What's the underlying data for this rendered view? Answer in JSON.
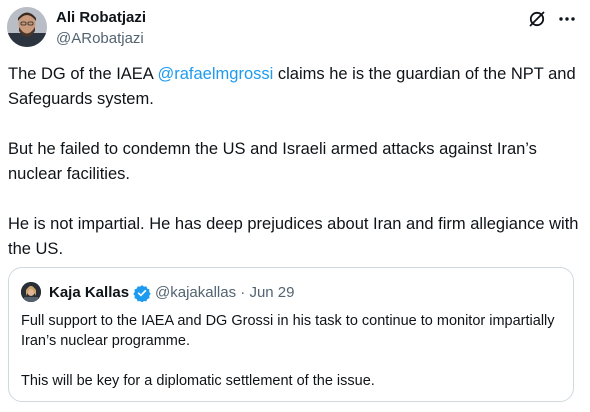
{
  "author": {
    "name": "Ali Robatjazi",
    "handle": "@ARobatjazi",
    "avatar_icon": "profile-photo"
  },
  "actions": {
    "grok_icon": "slashed-circle-icon",
    "more_icon": "three-dots-icon"
  },
  "tweet": {
    "p1_prefix": "The DG of the IAEA ",
    "p1_mention": "@rafaelmgrossi",
    "p1_suffix": " claims he is the guardian of the NPT and Safeguards system.",
    "p2": "But he failed to condemn the US and Israeli armed attacks against Iran’s nuclear facilities.",
    "p3": "He is not impartial. He has deep prejudices about Iran and firm allegiance with the US."
  },
  "quote": {
    "name": "Kaja Kallas",
    "handle": "@kajakallas",
    "separator": "·",
    "date": "Jun 29",
    "p1": "Full support to the IAEA and DG Grossi in his task to continue to monitor impartially Iran’s nuclear programme.",
    "p2": "This will be key for a diplomatic settlement of the issue."
  },
  "colors": {
    "text": "#0f1419",
    "secondary": "#536471",
    "link": "#1d9bf0",
    "border": "#cfd9de",
    "verified": "#1d9bf0"
  }
}
